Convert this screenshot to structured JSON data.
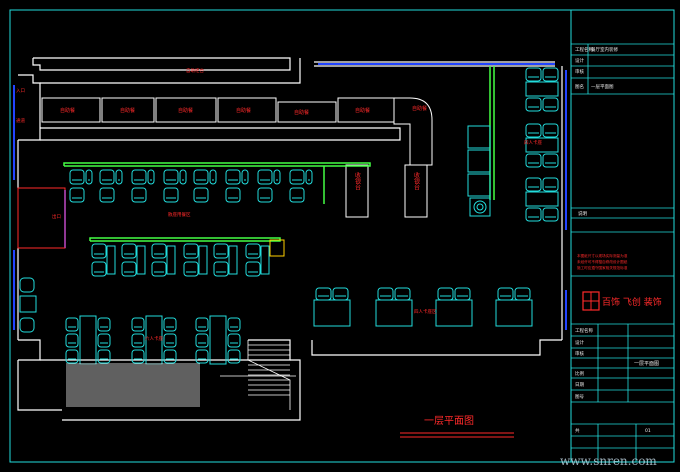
{
  "drawing": {
    "title": "一层平面图",
    "watermark": "www.snren.com",
    "colors": {
      "background": "#000000",
      "frame": "#22dddd",
      "wall": "#ffffff",
      "furniture": "#22dddd",
      "glass": "#2244ff",
      "bar": "#44ff44",
      "label": "#ff2a2a"
    }
  },
  "room_labels": {
    "main_counter": "自助柜台",
    "booth_seating": "散座用餐区",
    "four_seat_area": "四人卡座区",
    "entry_counter": "收银台",
    "stair_dining": "六人卡座",
    "window_zone": "入口",
    "left_corridor": "通道",
    "left_entry": "出口",
    "right_booths": "四人卡座",
    "service_1": "收银台",
    "service_2": "收银台",
    "left_panel": "通道区域"
  },
  "counter_cells": [
    "自助餐",
    "自助餐",
    "自助餐",
    "自助餐",
    "自助餐",
    "自助餐",
    "自助餐"
  ],
  "title_block": {
    "company_name": "百饰 飞创 装饰",
    "rows": [
      {
        "label": "工程名称",
        "value": "餐厅室内装修"
      },
      {
        "label": "设计",
        "value": ""
      },
      {
        "label": "审核",
        "value": ""
      },
      {
        "label": "图名",
        "value": "一层平面图"
      },
      {
        "label": "比例",
        "value": ""
      },
      {
        "label": "日期",
        "value": ""
      },
      {
        "label": "图号",
        "value": ""
      }
    ],
    "notes_heading": "说明",
    "notes": [
      "本图纸尺寸以现场实际测量为准",
      "未经许可不得擅自修改设计图纸",
      "施工时应遵守国家相关规范标准"
    ],
    "sheet_label": "共",
    "sheet_value": "01"
  }
}
